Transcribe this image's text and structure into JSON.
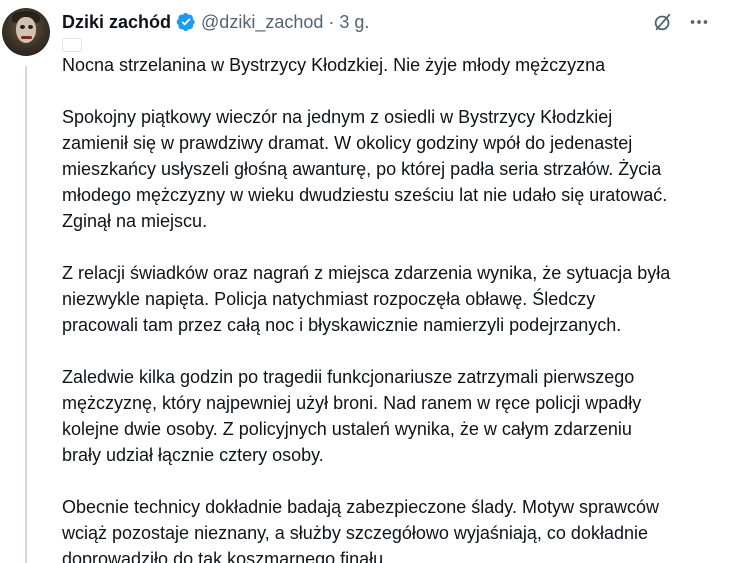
{
  "author": {
    "name": "Dziki zachód",
    "handle": "@dziki_zachod",
    "separator": "·",
    "time": "3 g."
  },
  "icons": {
    "verified": "verified-badge-icon",
    "grok": "grok-icon",
    "more": "more-dots-icon",
    "flag": "poland-flag-icon"
  },
  "colors": {
    "text": "#0f1419",
    "secondary": "#536471",
    "verified": "#1d9bf0",
    "thread_line": "#cfd9de"
  },
  "tweet": {
    "headline": "Nocna strzelanina w Bystrzycy Kłodzkiej. Nie żyje młody mężczyzna",
    "paragraphs": [
      [
        "Spokojny piątkowy wieczór na jednym z osiedli w Bystrzycy Kłodzkiej",
        "zamienił się w prawdziwy dramat. W okolicy godziny wpół do jedenastej",
        "mieszkańcy usłyszeli głośną awanturę, po której padła seria strzałów. Życia",
        "młodego mężczyzny w wieku dwudziestu sześciu lat nie udało się uratować.",
        "Zginął na miejscu."
      ],
      [
        "Z relacji świadków oraz nagrań z miejsca zdarzenia wynika, że sytuacja była",
        "niezwykle napięta. Policja natychmiast rozpoczęła obławę. Śledczy",
        "pracowali tam przez całą noc i błyskawicznie namierzyli podejrzanych."
      ],
      [
        "Zaledwie kilka godzin po tragedii funkcjonariusze zatrzymali pierwszego",
        "mężczyznę, który najpewniej użył broni. Nad ranem w ręce policji wpadły",
        "kolejne dwie osoby. Z policyjnych ustaleń wynika, że w całym zdarzeniu",
        "brały udział łącznie cztery osoby."
      ],
      [
        "Obecnie technicy dokładnie badają zabezpieczone ślady. Motyw sprawców",
        "wciąż pozostaje nieznany, a służby szczegółowo wyjaśniają, co dokładnie",
        "doprowadziło do tak koszmarnego finału."
      ]
    ]
  }
}
